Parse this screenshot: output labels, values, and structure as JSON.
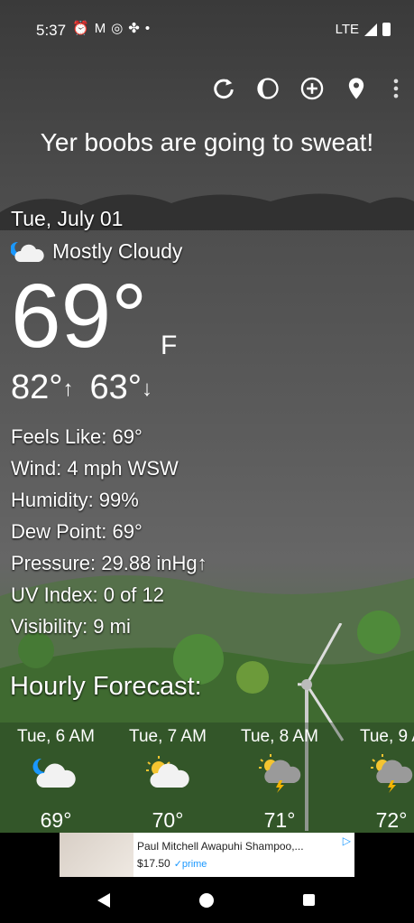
{
  "status_bar": {
    "time": "5:37",
    "icons": [
      "alarm-icon",
      "gmail-icon",
      "instagram-icon",
      "pinwheel-icon",
      "dot-icon"
    ],
    "network": "LTE"
  },
  "toolbar": {
    "icons": [
      "refresh-icon",
      "moon-phase-icon",
      "add-location-icon",
      "location-pin-icon",
      "overflow-menu-icon"
    ]
  },
  "banner": "Yer boobs are going to sweat!",
  "current": {
    "date": "Tue, July 01",
    "condition": "Mostly Cloudy",
    "condition_icon": "night-cloud-icon",
    "temperature": "69°",
    "unit": "F",
    "high": "82°",
    "low": "63°",
    "high_arrow": "↑",
    "low_arrow": "↓"
  },
  "details": {
    "feels_like": "Feels Like:  69°",
    "wind": "Wind:  4 mph WSW",
    "humidity": "Humidity:  99%",
    "dew_point": "Dew Point:  69°",
    "pressure": "Pressure:  29.88 inHg↑",
    "uv_index": "UV Index:  0 of 12",
    "visibility": "Visibility:  9 mi"
  },
  "hourly_title": "Hourly Forecast:",
  "hourly": [
    {
      "time": "Tue, 6 AM",
      "temp": "69°",
      "icon": "night-cloud-icon"
    },
    {
      "time": "Tue, 7 AM",
      "temp": "70°",
      "icon": "sun-cloud-icon"
    },
    {
      "time": "Tue, 8 AM",
      "temp": "71°",
      "icon": "sun-thunderstorm-icon"
    },
    {
      "time": "Tue, 9 A",
      "temp": "72°",
      "icon": "sun-thunderstorm-icon"
    }
  ],
  "ad": {
    "title": "Paul Mitchell Awapuhi Shampoo,...",
    "price": "$17.50",
    "badge": "✓prime"
  },
  "colors": {
    "accent_blue": "#1a98ff",
    "sun": "#f4c430",
    "bolt": "#f4b400"
  }
}
